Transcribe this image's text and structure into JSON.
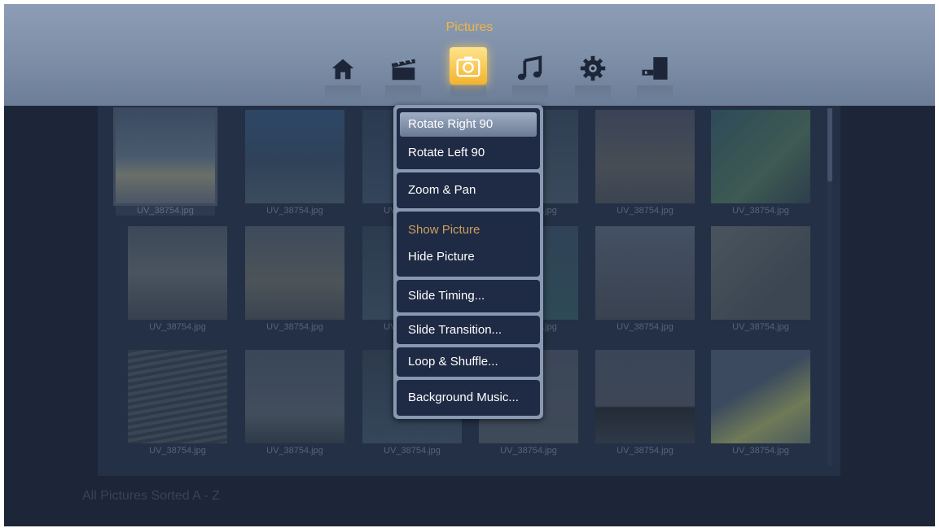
{
  "topbar": {
    "section_title": "Pictures",
    "icons": [
      "home-icon",
      "movies-icon",
      "pictures-icon",
      "music-icon",
      "settings-icon",
      "device-icon"
    ],
    "accent_color": "#f2b540"
  },
  "grid": {
    "thumbnail_label": "UV_38754.jpg",
    "tiles": [
      {
        "label": "UV_38754.jpg"
      },
      {
        "label": "UV_38754.jpg"
      },
      {
        "label": "UV_38754.jpg"
      },
      {
        "label": "UV_38754.jpg"
      },
      {
        "label": "UV_38754.jpg"
      },
      {
        "label": "UV_38754.jpg"
      },
      {
        "label": "UV_38754.jpg"
      },
      {
        "label": "UV_38754.jpg"
      },
      {
        "label": "UV_38754.jpg"
      },
      {
        "label": "UV_38754.jpg"
      },
      {
        "label": "UV_38754.jpg"
      },
      {
        "label": "UV_38754.jpg"
      },
      {
        "label": "UV_38754.jpg"
      },
      {
        "label": "UV_38754.jpg"
      },
      {
        "label": "UV_38754.jpg"
      },
      {
        "label": "UV_38754.jpg"
      },
      {
        "label": "UV_38754.jpg"
      },
      {
        "label": "UV_38754.jpg"
      }
    ]
  },
  "footer": {
    "sort_label": "All Pictures Sorted A - Z"
  },
  "menu": {
    "rotate_right": "Rotate Right 90",
    "rotate_left": "Rotate Left 90",
    "zoom_pan": "Zoom & Pan",
    "show_picture": "Show Picture",
    "hide_picture": "Hide Picture",
    "slide_timing": "Slide Timing...",
    "slide_transition": "Slide Transition...",
    "loop_shuffle": "Loop & Shuffle...",
    "background_music": "Background Music..."
  }
}
